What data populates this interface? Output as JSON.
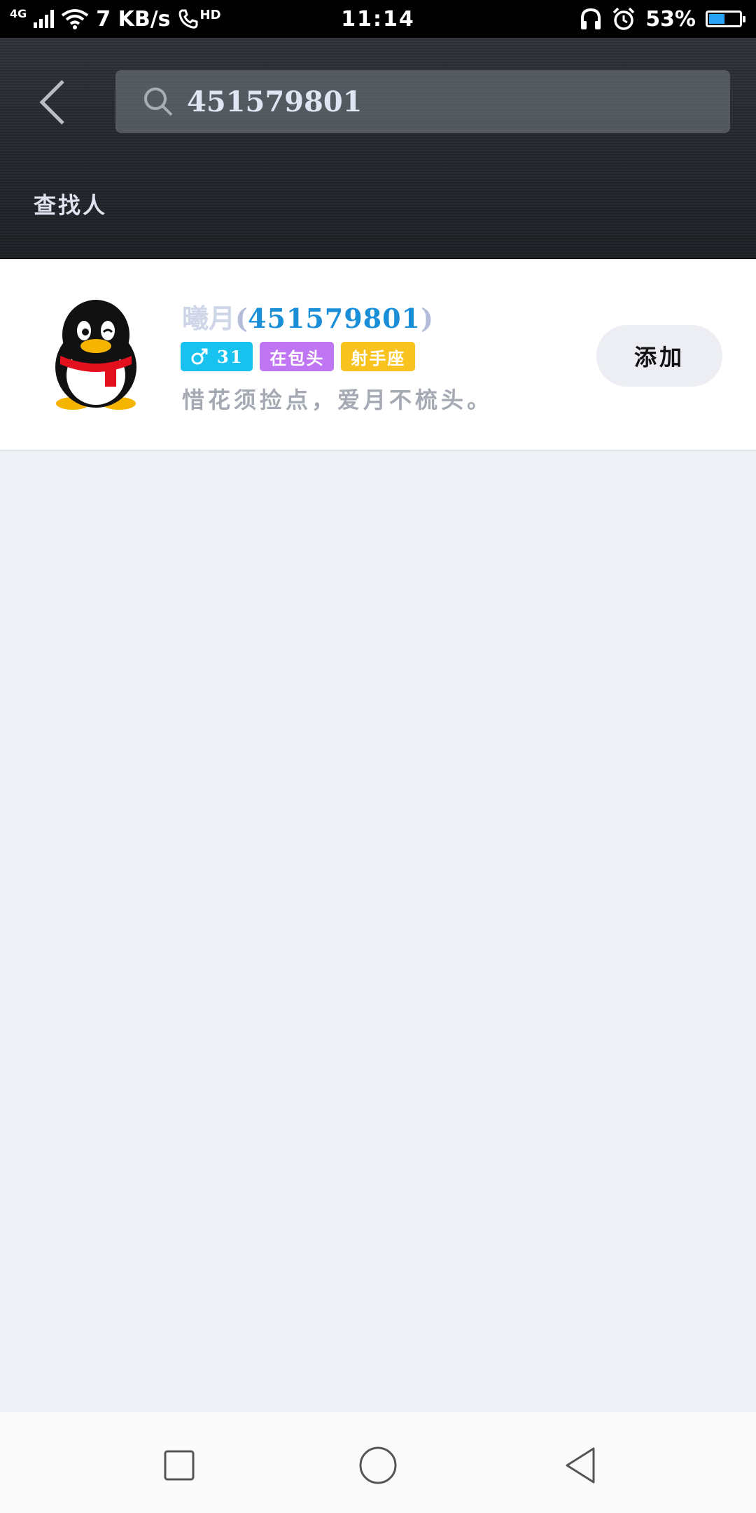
{
  "status_bar": {
    "network": "4G",
    "speed": "7 KB/s",
    "hd": "HD",
    "time": "11:14",
    "battery": "53%",
    "battery_level": 0.53
  },
  "header": {
    "search_value": "451579801",
    "section_title": "查找人"
  },
  "result": {
    "name": "曦月",
    "paren_open": "(",
    "qq_number": "451579801",
    "paren_close": ")",
    "tags": {
      "age": "31",
      "location": "在包头",
      "zodiac": "射手座"
    },
    "signature": "惜花须捡点，爱月不梳头。",
    "add_label": "添加"
  },
  "icons": {
    "back": "chevron-left-icon",
    "search": "search-icon",
    "male": "male-icon",
    "nav_recent": "square-icon",
    "nav_home": "circle-icon",
    "nav_back": "triangle-left-icon"
  },
  "colors": {
    "header_bg": "#2a2e33",
    "qq_number": "#1a8fd8",
    "tag_age": "#17c2ef",
    "tag_location": "#c076f2",
    "tag_zodiac": "#f8c21f",
    "page_bg": "#eff1f6"
  }
}
